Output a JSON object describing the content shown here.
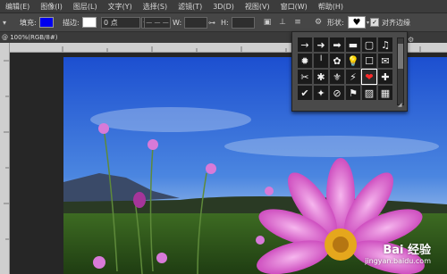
{
  "menu": [
    "编辑(E)",
    "图像(I)",
    "图层(L)",
    "文字(Y)",
    "选择(S)",
    "滤镜(T)",
    "3D(D)",
    "视图(V)",
    "窗口(W)",
    "帮助(H)"
  ],
  "options": {
    "fill_label": "填充:",
    "fill_color": "#0000ee",
    "stroke_label": "描边:",
    "stroke_color": "#ffffff",
    "stroke_width": "0 点",
    "w_label": "W:",
    "h_label": "H:",
    "shape_label": "形状:",
    "align_edges_label": "对齐边缘"
  },
  "tab": {
    "title": "@ 100%(RGB/8#)"
  },
  "shape_picker": {
    "rows": [
      [
        "→",
        "➜",
        "➡",
        "▬",
        "▢",
        "♫"
      ],
      [
        "✹",
        "╵",
        "✿",
        "💡",
        "☐",
        "✉"
      ],
      [
        "✂",
        "✱",
        "⚜",
        "⚡",
        "❤",
        "✚"
      ],
      [
        "✔",
        "✦",
        "⊘",
        "⚑",
        "▨",
        "▦"
      ]
    ],
    "selected": "❤"
  },
  "watermark": {
    "brand": "Bai  经验",
    "url": "jingyan.baidu.com"
  }
}
